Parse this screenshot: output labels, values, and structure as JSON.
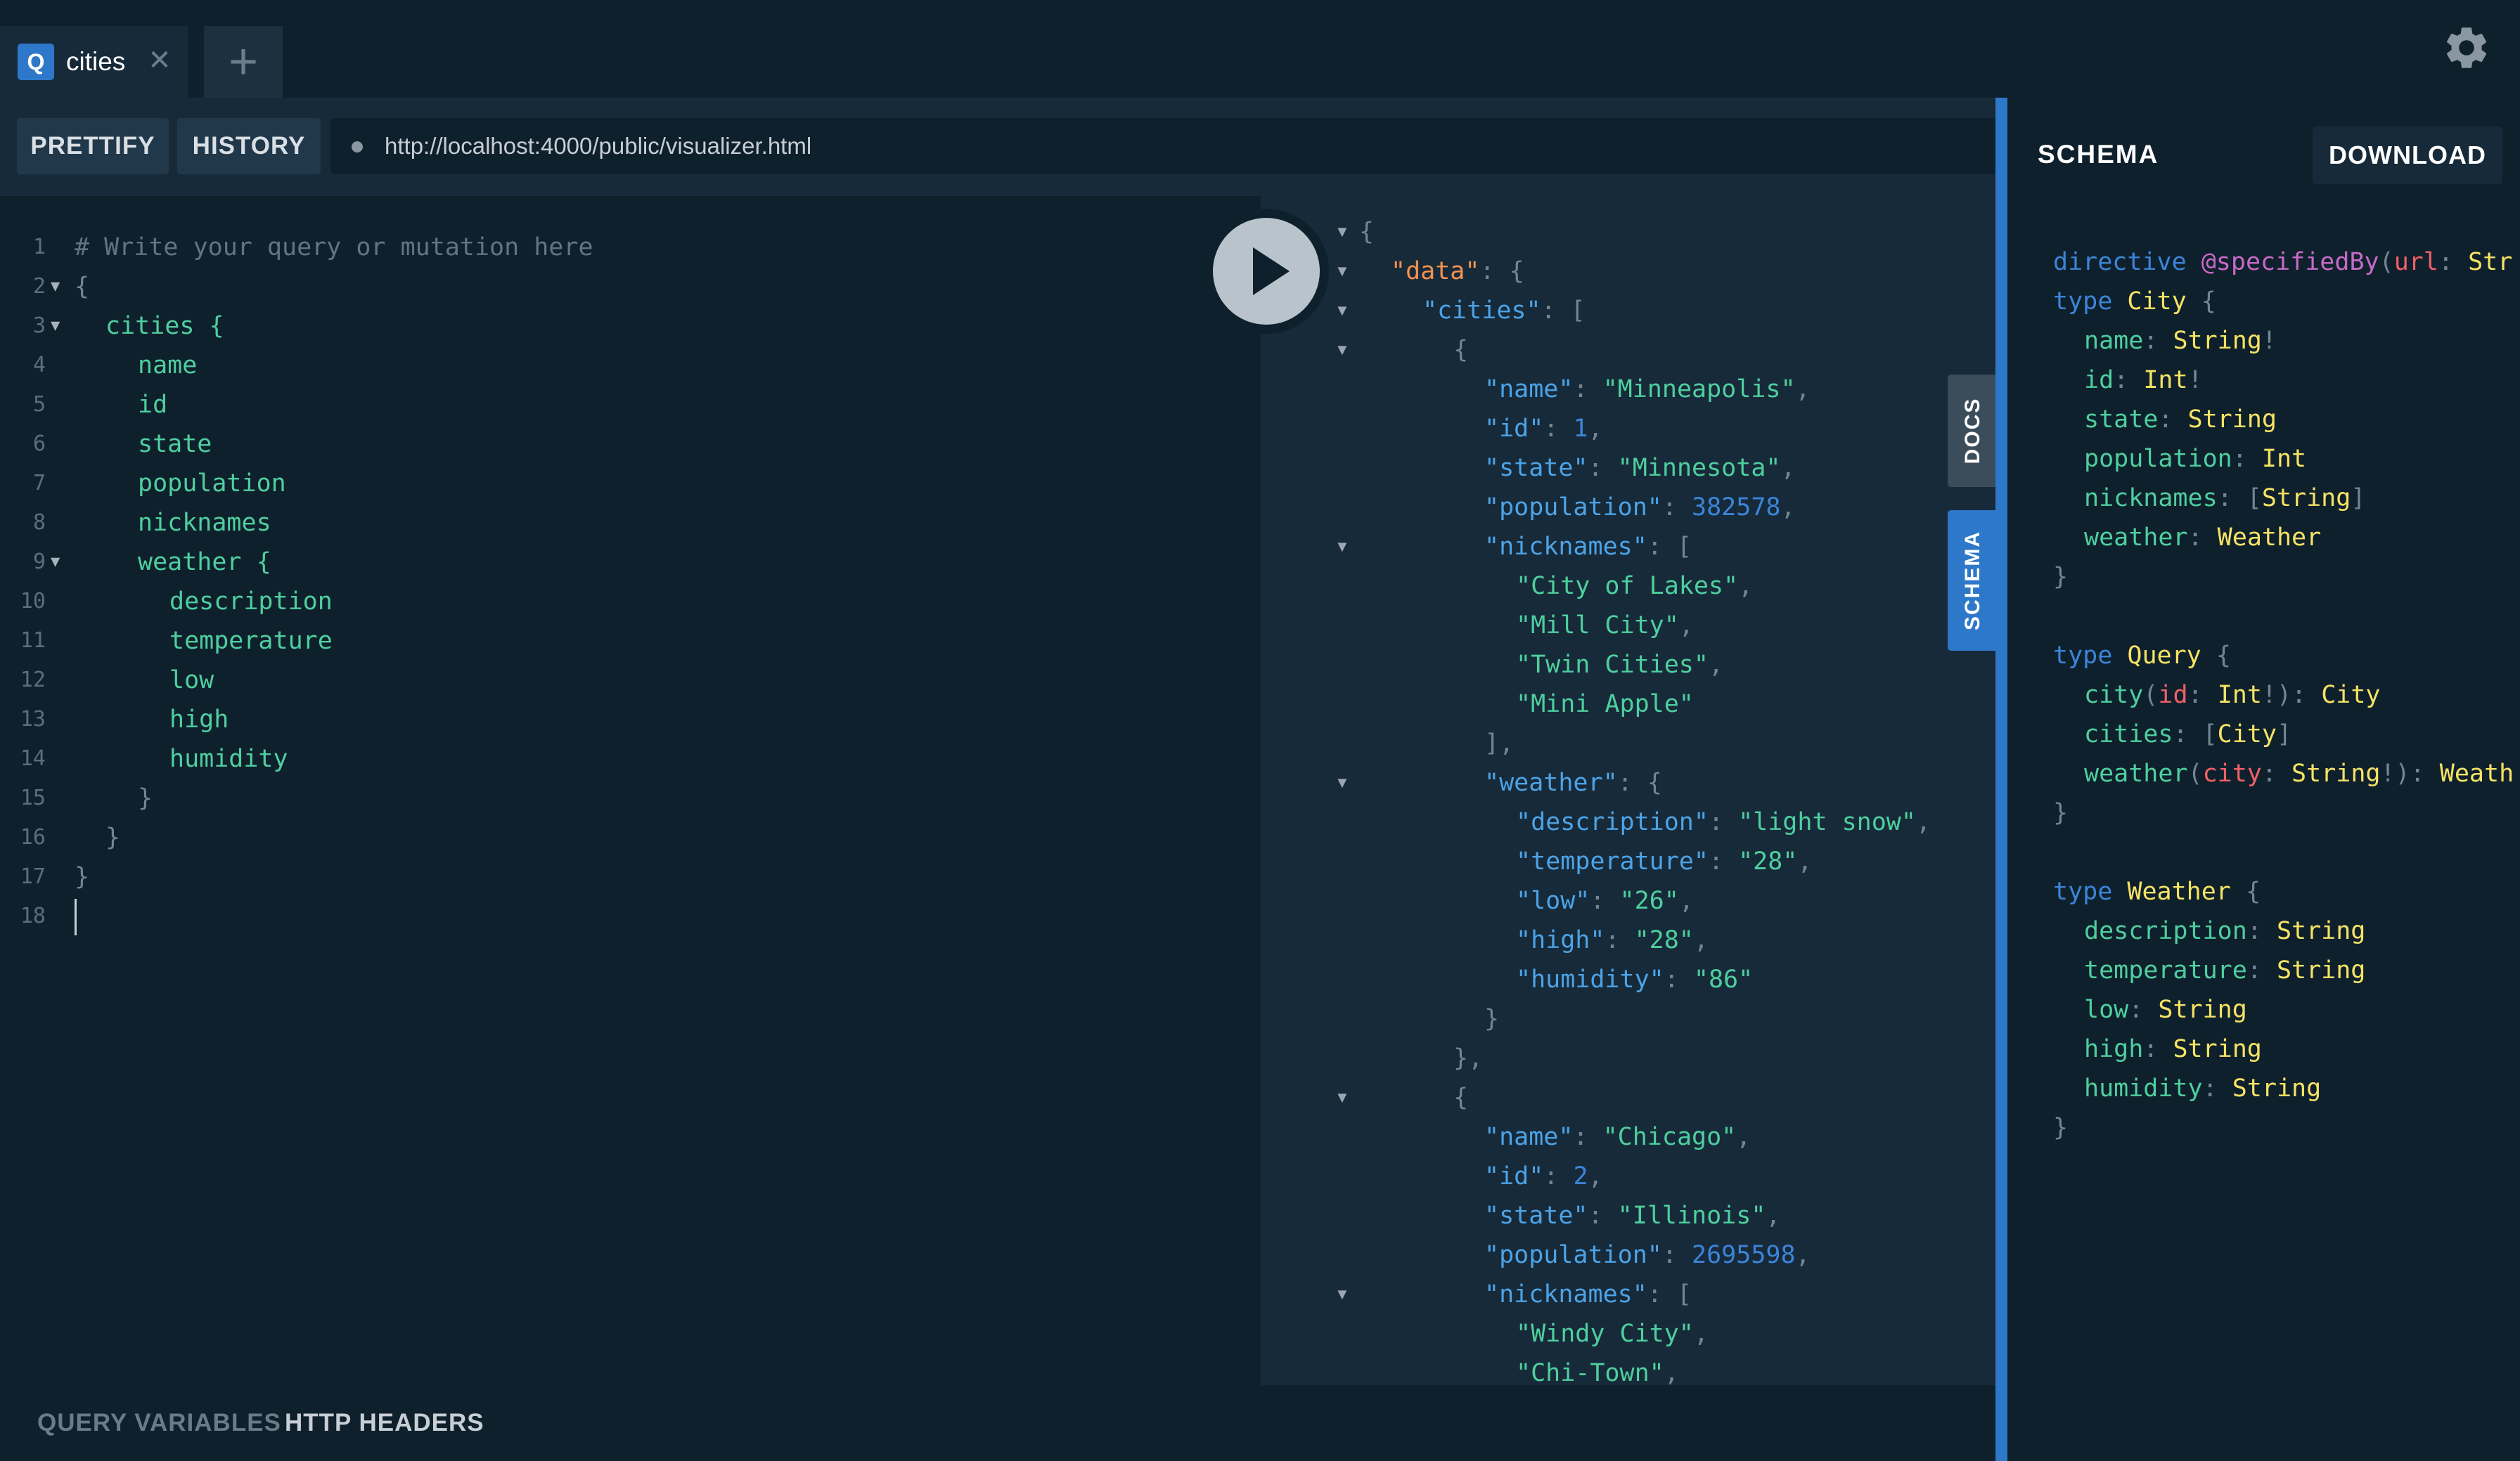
{
  "tabs": [
    {
      "badge": "Q",
      "title": "cities",
      "close": "✕"
    }
  ],
  "add_tab": "+",
  "toolbar": {
    "prettify": "PRETTIFY",
    "history": "HISTORY",
    "url": "http://localhost:4000/public/visualizer.html"
  },
  "query_lines": [
    {
      "n": "1",
      "text": "# Write your query or mutation here"
    },
    {
      "n": "2",
      "text": "{"
    },
    {
      "n": "3",
      "text": "cities {"
    },
    {
      "n": "4",
      "text": "name"
    },
    {
      "n": "5",
      "text": "id"
    },
    {
      "n": "6",
      "text": "state"
    },
    {
      "n": "7",
      "text": "population"
    },
    {
      "n": "8",
      "text": "nicknames"
    },
    {
      "n": "9",
      "text": "weather {"
    },
    {
      "n": "10",
      "text": "description"
    },
    {
      "n": "11",
      "text": "temperature"
    },
    {
      "n": "12",
      "text": "low"
    },
    {
      "n": "13",
      "text": "high"
    },
    {
      "n": "14",
      "text": "humidity"
    },
    {
      "n": "15",
      "text": "}"
    },
    {
      "n": "16",
      "text": "}"
    },
    {
      "n": "17",
      "text": "}"
    },
    {
      "n": "18",
      "text": ""
    }
  ],
  "result": {
    "data_key": "\"data\"",
    "cities_key": "\"cities\"",
    "city1": {
      "name": "\"Minneapolis\"",
      "id": "1",
      "state": "\"Minnesota\"",
      "population": "382578",
      "nicknames": [
        "\"City of Lakes\"",
        "\"Mill City\"",
        "\"Twin Cities\"",
        "\"Mini Apple\""
      ],
      "weather": {
        "description": "\"light snow\"",
        "temperature": "\"28\"",
        "low": "\"26\"",
        "high": "\"28\"",
        "humidity": "\"86\""
      }
    },
    "city2": {
      "name": "\"Chicago\"",
      "id": "2",
      "state": "\"Illinois\"",
      "population": "2695598",
      "nicknames": [
        "\"Windy City\"",
        "\"Chi-Town\""
      ]
    },
    "keys": {
      "name": "\"name\"",
      "id": "\"id\"",
      "state": "\"state\"",
      "population": "\"population\"",
      "nicknames": "\"nicknames\"",
      "weather": "\"weather\"",
      "description": "\"description\"",
      "temperature": "\"temperature\"",
      "low": "\"low\"",
      "high": "\"high\"",
      "humidity": "\"humidity\""
    }
  },
  "side_tabs": {
    "docs": "DOCS",
    "schema": "SCHEMA"
  },
  "schema_panel": {
    "title": "SCHEMA",
    "download": "DOWNLOAD",
    "sdl": {
      "directive_kw": "directive",
      "directive_name": "@specifiedBy",
      "directive_arg": "url",
      "directive_rest": "Str",
      "type_kw": "type",
      "city_type": "City",
      "query_type": "Query",
      "weather_type": "Weather",
      "String": "String",
      "Int": "Int",
      "f_name": "name",
      "f_id": "id",
      "f_state": "state",
      "f_population": "population",
      "f_nicknames": "nicknames",
      "f_weather": "weather",
      "f_city": "city",
      "f_cities": "cities",
      "f_description": "description",
      "f_temperature": "temperature",
      "f_low": "low",
      "f_high": "high",
      "f_humidity": "humidity",
      "a_id": "id",
      "a_city": "city",
      "weath_trunc": "Weath"
    }
  },
  "bottom": {
    "query_variables": "QUERY VARIABLES",
    "http_headers": "HTTP HEADERS"
  },
  "colors": {
    "accent": "#2e78c9",
    "field": "#4ecf9e",
    "type": "#f6e363",
    "keyword": "#3b85d8"
  }
}
